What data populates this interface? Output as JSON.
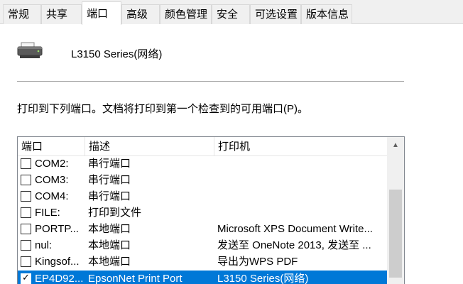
{
  "tabs": [
    {
      "label": "常规",
      "active": false
    },
    {
      "label": "共享",
      "active": false
    },
    {
      "label": "端口",
      "active": true
    },
    {
      "label": "高级",
      "active": false
    },
    {
      "label": "颜色管理",
      "active": false
    },
    {
      "label": "安全",
      "active": false
    },
    {
      "label": "可选设置",
      "active": false
    },
    {
      "label": "版本信息",
      "active": false
    }
  ],
  "printer": {
    "name": "L3150 Series(网络)",
    "icon": "printer-icon"
  },
  "description": "打印到下列端口。文档将打印到第一个检查到的可用端口(P)。",
  "port_list": {
    "columns": [
      "端口",
      "描述",
      "打印机"
    ],
    "rows": [
      {
        "port": "COM2:",
        "desc": "串行端口",
        "printer": "",
        "checked": false,
        "selected": false
      },
      {
        "port": "COM3:",
        "desc": "串行端口",
        "printer": "",
        "checked": false,
        "selected": false
      },
      {
        "port": "COM4:",
        "desc": "串行端口",
        "printer": "",
        "checked": false,
        "selected": false
      },
      {
        "port": "FILE:",
        "desc": "打印到文件",
        "printer": "",
        "checked": false,
        "selected": false
      },
      {
        "port": "PORTP...",
        "desc": "本地端口",
        "printer": "Microsoft XPS Document Write...",
        "checked": false,
        "selected": false
      },
      {
        "port": "nul:",
        "desc": "本地端口",
        "printer": "发送至 OneNote 2013, 发送至 ...",
        "checked": false,
        "selected": false
      },
      {
        "port": "Kingsof...",
        "desc": "本地端口",
        "printer": "导出为WPS PDF",
        "checked": false,
        "selected": false
      },
      {
        "port": "EP4D92...",
        "desc": "EpsonNet Print Port",
        "printer": "L3150 Series(网络)",
        "checked": true,
        "selected": true
      }
    ]
  },
  "colors": {
    "selection": "#0078d7",
    "tab_bar": "#f0f0f0"
  }
}
